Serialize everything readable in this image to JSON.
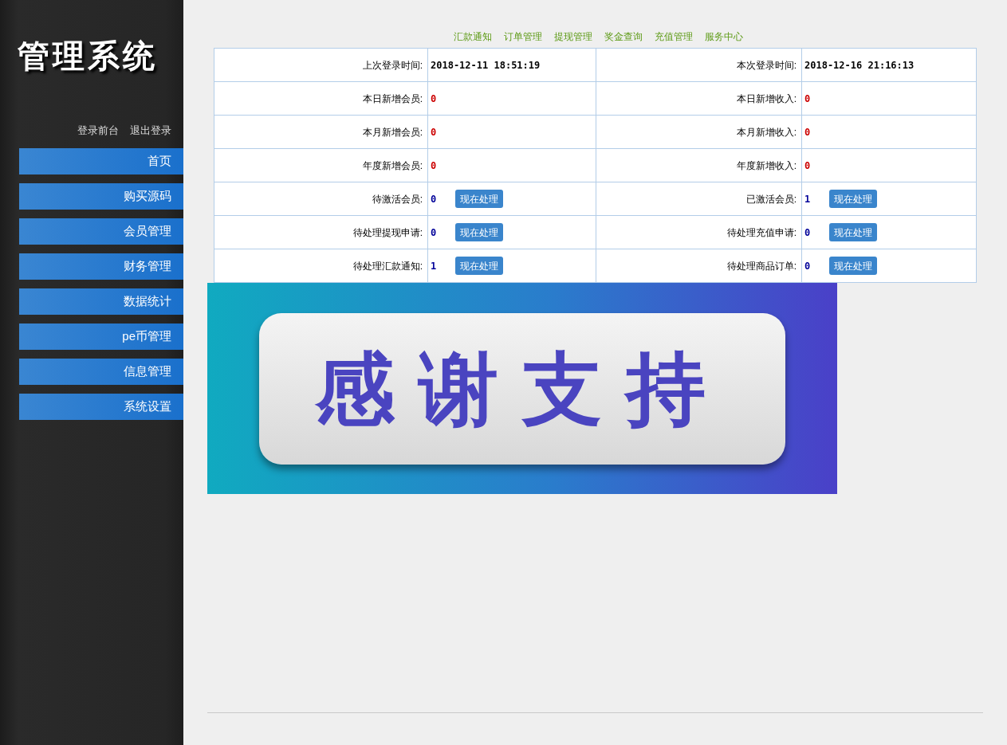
{
  "sidebar": {
    "title": "管理系统",
    "links": [
      "登录前台",
      "退出登录"
    ],
    "menu": [
      "首页",
      "购买源码",
      "会员管理",
      "财务管理",
      "数据统计",
      "pe币管理",
      "信息管理",
      "系统设置"
    ]
  },
  "top_nav": [
    "汇款通知",
    "订单管理",
    "提现管理",
    "奖金查询",
    "充值管理",
    "服务中心"
  ],
  "table": {
    "rows": [
      {
        "cells": [
          {
            "label": "上次登录时间:",
            "value": "2018-12-11 18:51:19",
            "color": "#000000"
          },
          {
            "label": "本次登录时间:",
            "value": "2018-12-16 21:16:13",
            "color": "#000000"
          }
        ]
      },
      {
        "cells": [
          {
            "label": "本日新增会员:",
            "value": "0",
            "color": "#cc0000"
          },
          {
            "label": "本日新增收入:",
            "value": "0",
            "color": "#cc0000"
          }
        ]
      },
      {
        "cells": [
          {
            "label": "本月新增会员:",
            "value": "0",
            "color": "#cc0000"
          },
          {
            "label": "本月新增收入:",
            "value": "0",
            "color": "#cc0000"
          }
        ]
      },
      {
        "cells": [
          {
            "label": "年度新增会员:",
            "value": "0",
            "color": "#cc0000"
          },
          {
            "label": "年度新增收入:",
            "value": "0",
            "color": "#cc0000"
          }
        ]
      },
      {
        "cells": [
          {
            "label": "待激活会员:",
            "value": "0",
            "color": "#000099",
            "button": "现在处理"
          },
          {
            "label": "已激活会员:",
            "value": "1",
            "color": "#000099",
            "button": "现在处理"
          }
        ]
      },
      {
        "cells": [
          {
            "label": "待处理提现申请:",
            "value": "0",
            "color": "#000099",
            "button": "现在处理"
          },
          {
            "label": "待处理充值申请:",
            "value": "0",
            "color": "#000099",
            "button": "现在处理"
          }
        ]
      },
      {
        "cells": [
          {
            "label": "待处理汇款通知:",
            "value": "1",
            "color": "#000099",
            "button": "现在处理"
          },
          {
            "label": "待处理商品订单:",
            "value": "0",
            "color": "#000099",
            "button": "现在处理"
          }
        ]
      }
    ]
  },
  "banner": {
    "text": "感谢支持"
  }
}
